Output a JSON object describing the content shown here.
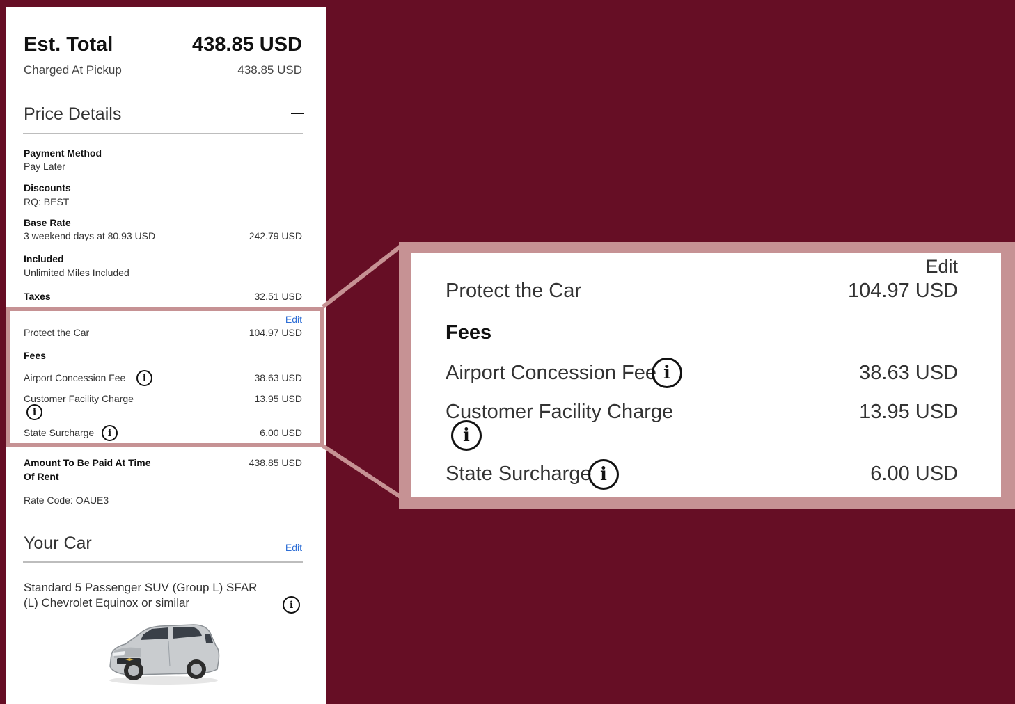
{
  "summary": {
    "est_total_label": "Est. Total",
    "est_total_value": "438.85 USD",
    "charged_label": "Charged At Pickup",
    "charged_value": "438.85 USD"
  },
  "price_details": {
    "title": "Price Details",
    "payment_method_label": "Payment Method",
    "payment_method_value": "Pay Later",
    "discounts_label": "Discounts",
    "discounts_value": "RQ: BEST",
    "base_rate_label": "Base Rate",
    "base_rate_desc": "3 weekend days at 80.93 USD",
    "base_rate_value": "242.79 USD",
    "included_label": "Included",
    "included_value": "Unlimited Miles Included",
    "taxes_label": "Taxes",
    "taxes_value": "32.51 USD",
    "edit_label": "Edit",
    "protect_label": "Protect the Car",
    "protect_value": "104.97 USD",
    "fees_label": "Fees",
    "airport_fee_label": "Airport Concession Fee",
    "airport_fee_value": "38.63 USD",
    "facility_label": "Customer Facility Charge",
    "facility_value": "13.95 USD",
    "state_label": "State Surcharge",
    "state_value": "6.00 USD",
    "amount_label_line1": "Amount To Be Paid At Time",
    "amount_label_line2": "Of Rent",
    "amount_value": "438.85 USD",
    "rate_code": "Rate Code: OAUE3"
  },
  "your_car": {
    "title": "Your Car",
    "edit_label": "Edit",
    "desc_line1": "Standard 5 Passenger SUV (Group L) SFAR",
    "desc_line2": "(L) Chevrolet Equinox or similar"
  },
  "info_glyph": "i",
  "colors": {
    "background": "#660e25",
    "highlight": "#c69294",
    "link": "#2f6fd6"
  }
}
